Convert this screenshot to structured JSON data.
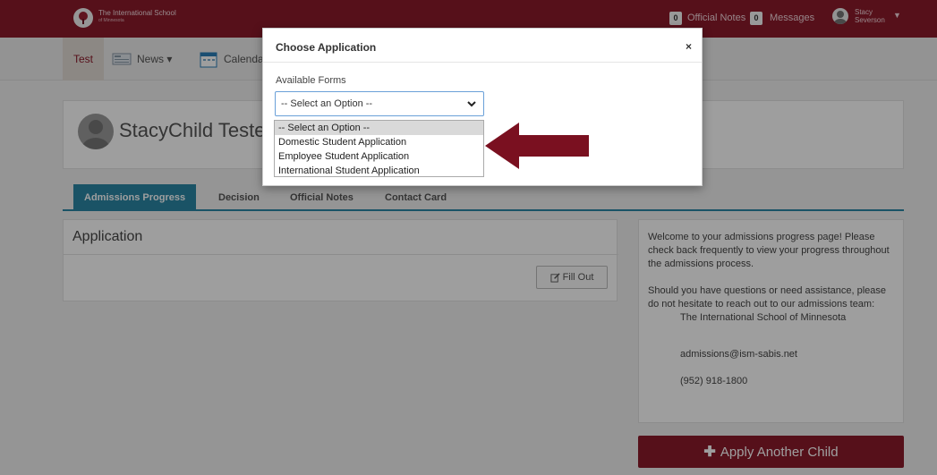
{
  "header": {
    "school_name": "The International School",
    "school_sub": "of Minnesota",
    "official_notes_count": "0",
    "official_notes_label": "Official Notes",
    "messages_count": "0",
    "messages_label": "Messages",
    "user_first": "Stacy",
    "user_last": "Severson"
  },
  "nav": {
    "items": [
      {
        "label": "Test"
      },
      {
        "label": "News ▾"
      },
      {
        "label": "Calendar"
      }
    ]
  },
  "profile": {
    "name": "StacyChild Tester"
  },
  "tabs": [
    {
      "label": "Admissions Progress"
    },
    {
      "label": "Decision"
    },
    {
      "label": "Official Notes"
    },
    {
      "label": "Contact Card"
    }
  ],
  "application": {
    "title": "Application",
    "fill_out_label": "Fill Out"
  },
  "side_panel": {
    "welcome": "Welcome to your admissions progress page! Please check back frequently to view your progress throughout the admissions process.",
    "questions": "Should you have questions or need assistance, please do not hesitate to reach out to our admissions team:",
    "school": "The International School of Minnesota",
    "email": "admissions@ism-sabis.net",
    "phone": "(952) 918-1800"
  },
  "apply_button": "Apply Another Child",
  "modal": {
    "title": "Choose Application",
    "close": "×",
    "label": "Available Forms",
    "selected_value": "-- Select an Option --",
    "options": [
      "-- Select an Option --",
      "Domestic Student Application",
      "Employee Student Application",
      "International Student Application"
    ]
  },
  "colors": {
    "brand": "#8c1a2b",
    "tab_active": "#2a86a5"
  }
}
